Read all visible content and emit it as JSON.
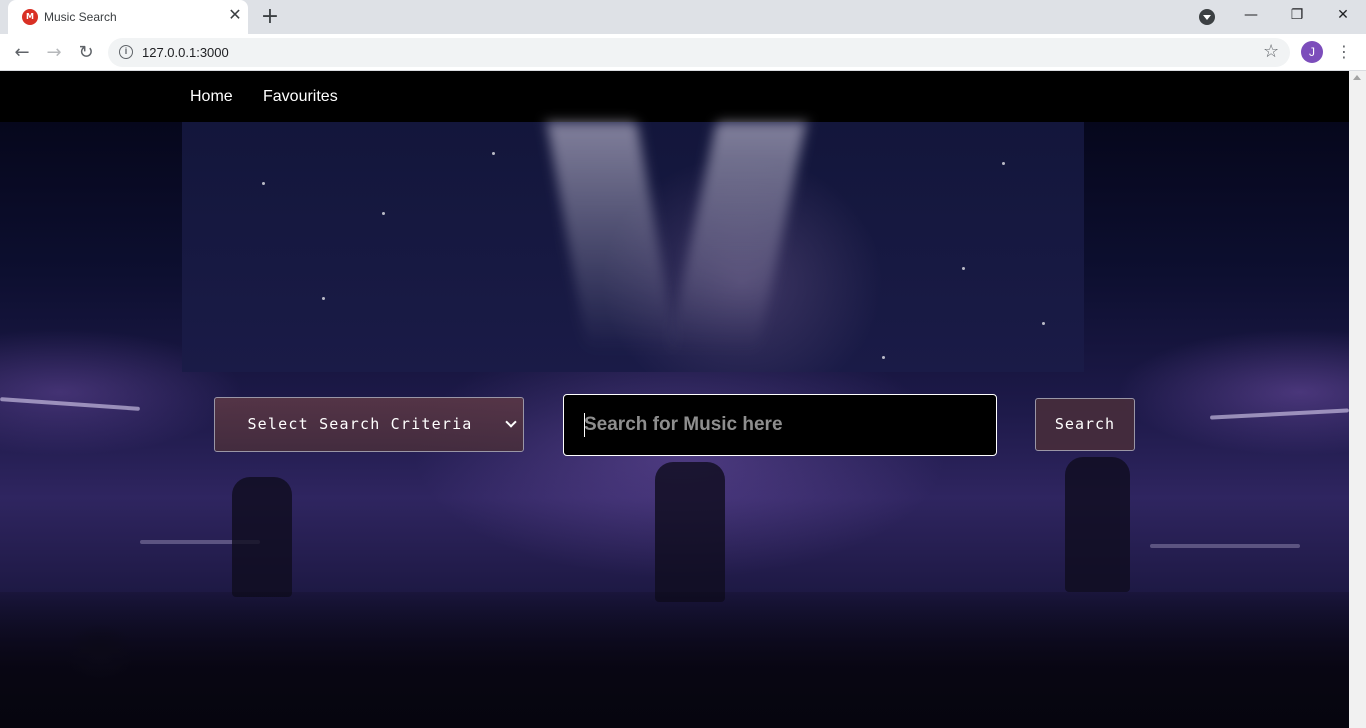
{
  "browser": {
    "tab_title": "Music Search",
    "favicon_text": "M",
    "url": "127.0.0.1:3000",
    "profile_initial": "J",
    "window_controls": {
      "minimize": "—",
      "maximize": "❐",
      "close": "✕"
    }
  },
  "nav": {
    "links": [
      {
        "label": "Home"
      },
      {
        "label": "Favourites"
      }
    ]
  },
  "search": {
    "criteria_label": "Select Search Criteria",
    "placeholder": "Search for Music here",
    "value": "",
    "button_label": "Search"
  },
  "colors": {
    "navbar": "#000000",
    "accent_select": "#5a3746",
    "input_bg": "#000000",
    "avatar": "#7c4dbb"
  }
}
